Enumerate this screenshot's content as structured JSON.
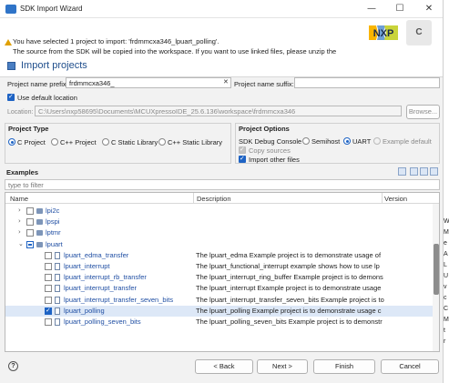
{
  "window": {
    "title": "SDK Import Wizard",
    "minimize": "—",
    "maximize": "☐",
    "close": "✕"
  },
  "header": {
    "message_line1": "You have selected 1 project to import: 'frdmmcxa346_lpuart_polling'.",
    "message_line2": "The source from the SDK will be copied into the workspace. If you want to use linked files, please unzip the",
    "page_title": "Import projects",
    "logo_text": "NXP",
    "logo_c": "C"
  },
  "form": {
    "prefix_label": "Project name prefix:",
    "prefix_value": "frdmmcxa346_",
    "suffix_label": "Project name suffix:",
    "suffix_value": "",
    "use_default_location_label": "Use default location",
    "use_default_location_checked": true,
    "location_label": "Location:",
    "location_value": "C:\\Users\\nxp58695\\Documents\\MCUXpressoIDE_25.6.136\\workspace\\frdmmcxa346",
    "browse_label": "Browse..."
  },
  "project_type": {
    "title": "Project Type",
    "options": [
      "C Project",
      "C++ Project",
      "C Static Library",
      "C++ Static Library"
    ],
    "selected": "C Project"
  },
  "project_options": {
    "title": "Project Options",
    "debug_console_label": "SDK Debug Console",
    "debug_options": [
      "Semihost",
      "UART",
      "Example default"
    ],
    "debug_selected": "UART",
    "copy_sources_label": "Copy sources",
    "import_other_files_label": "Import other files"
  },
  "examples": {
    "title": "Examples",
    "filter_placeholder": "type to filter",
    "columns": [
      "Name",
      "Description",
      "Version"
    ],
    "rows": [
      {
        "name": "lpi2c",
        "desc": "",
        "level": 1,
        "kind": "folder",
        "state": "unchecked",
        "expanded": false
      },
      {
        "name": "lpspi",
        "desc": "",
        "level": 1,
        "kind": "folder",
        "state": "unchecked",
        "expanded": false
      },
      {
        "name": "lptmr",
        "desc": "",
        "level": 1,
        "kind": "folder",
        "state": "unchecked",
        "expanded": false
      },
      {
        "name": "lpuart",
        "desc": "",
        "level": 1,
        "kind": "folder",
        "state": "partial",
        "expanded": true
      },
      {
        "name": "lpuart_edma_transfer",
        "desc": "The lpuart_edma Example project is to demonstrate usage of",
        "level": 2,
        "kind": "file",
        "state": "unchecked"
      },
      {
        "name": "lpuart_interrupt",
        "desc": "The lpuart_functional_interrupt example shows how to use lp",
        "level": 2,
        "kind": "file",
        "state": "unchecked"
      },
      {
        "name": "lpuart_interrupt_rb_transfer",
        "desc": "The lpuart_interrupt_ring_buffer Example project is to demons",
        "level": 2,
        "kind": "file",
        "state": "unchecked"
      },
      {
        "name": "lpuart_interrupt_transfer",
        "desc": "The lpuart_interrupt Example project is to demonstrate usage",
        "level": 2,
        "kind": "file",
        "state": "unchecked"
      },
      {
        "name": "lpuart_interrupt_transfer_seven_bits",
        "desc": "The lpuart_interrupt_transfer_seven_bits Example project is to",
        "level": 2,
        "kind": "file",
        "state": "unchecked"
      },
      {
        "name": "lpuart_polling",
        "desc": "The lpuart_polling Example project is to demonstrate usage c",
        "level": 2,
        "kind": "file",
        "state": "checked"
      },
      {
        "name": "lpuart_polling_seven_bits",
        "desc": "The lpuart_polling_seven_bits Example project is to demonstr",
        "level": 2,
        "kind": "file",
        "state": "unchecked"
      }
    ]
  },
  "buttons": {
    "help": "?",
    "back": "< Back",
    "next": "Next >",
    "finish": "Finish",
    "cancel": "Cancel"
  },
  "background_window": {
    "chars": [
      "W",
      "M",
      "e",
      "A",
      "L",
      "U",
      "v",
      "c",
      "C",
      "M",
      "t",
      "r"
    ]
  }
}
